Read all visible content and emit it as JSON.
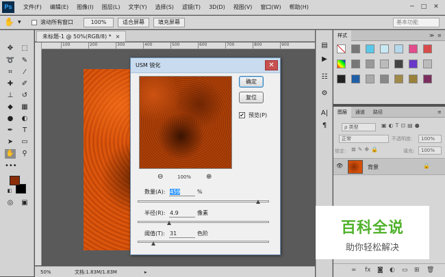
{
  "app": {
    "logo": "Ps"
  },
  "menu": [
    "文件(F)",
    "编辑(E)",
    "图像(I)",
    "图层(L)",
    "文字(Y)",
    "选择(S)",
    "滤镜(T)",
    "3D(D)",
    "视图(V)",
    "窗口(W)",
    "帮助(H)"
  ],
  "window_controls": {
    "minimize": "─",
    "restore": "□",
    "close": "✕"
  },
  "options": {
    "scroll_all_label": "滚动所有窗口",
    "zoom_btn": "100%",
    "fit_btn": "适合屏幕",
    "fill_btn": "填充屏幕",
    "workspace": "基本功能"
  },
  "document": {
    "tab_title": "未标题-1 @ 50%(RGB/8) *",
    "tab_close": "×",
    "ruler_ticks": [
      "100",
      "200",
      "300",
      "400",
      "500",
      "600",
      "700",
      "800",
      "900"
    ],
    "status_zoom": "50%",
    "status_doc": "文档:1.83M/1.83M",
    "status_arrow": "▸"
  },
  "dialog": {
    "title": "USM 锐化",
    "close": "✕",
    "ok": "确定",
    "reset": "复位",
    "preview_label": "预览(P)",
    "preview_checked": "✔",
    "zoom_level": "100%",
    "zoom_out_icon": "⊖",
    "zoom_in_icon": "⊕",
    "amount": {
      "label": "数量(A):",
      "value": "459",
      "unit": "%",
      "level_percent": 91.8
    },
    "radius": {
      "label": "半径(R):",
      "value": "4.9",
      "unit": "像素",
      "level_percent": 24
    },
    "threshold": {
      "label": "阈值(T):",
      "value": "31",
      "unit": "色阶",
      "level_percent": 12
    }
  },
  "styles_panel": {
    "tab": "样式",
    "collapse": "≫",
    "menu": "≡"
  },
  "layers_panel": {
    "tabs": [
      "图层",
      "通道",
      "路径"
    ],
    "menu": "≡",
    "filter_kind": "ρ 类型",
    "blend_mode": "正常",
    "opacity_label": "不透明度:",
    "opacity_value": "100%",
    "lock_label": "锁定:",
    "fill_label": "填充:",
    "fill_value": "100%",
    "layer_name": "背景",
    "eye_icon": "👁",
    "lock_icon": "🔒"
  },
  "watermark": {
    "title": "百科全说",
    "subtitle": "助你轻松解决"
  },
  "colors": {
    "foreground": "#8b2e08",
    "background": "#000000",
    "dialog_titlebar": "#c9dbee",
    "watermark_green": "#4fb12a",
    "canvas_orange": "#d4500a"
  },
  "icons": {
    "hand": "✋",
    "tools": [
      "move",
      "marquee",
      "lasso",
      "quick-select",
      "crop",
      "eyedropper",
      "healing",
      "brush",
      "clone",
      "history-brush",
      "eraser",
      "gradient",
      "blur",
      "dodge",
      "pen",
      "type",
      "path-select",
      "shape",
      "hand",
      "zoom"
    ],
    "dock": [
      "history",
      "actions",
      "properties",
      "paragraph-type",
      "character"
    ]
  }
}
